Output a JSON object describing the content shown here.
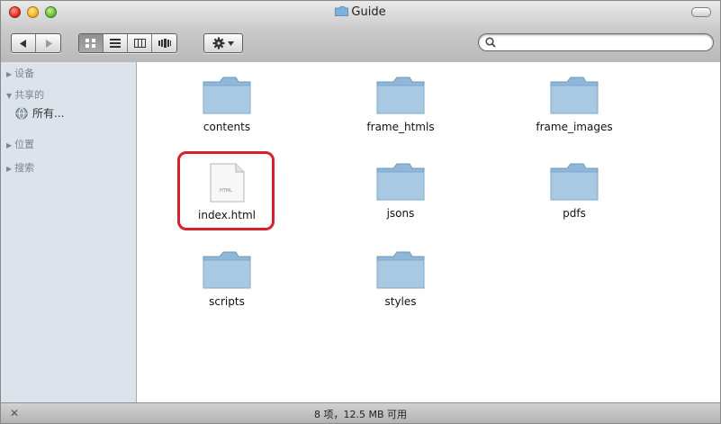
{
  "window": {
    "title": "Guide"
  },
  "sidebar": {
    "sections": [
      {
        "label": "设备"
      },
      {
        "label": "共享的"
      },
      {
        "label": "位置"
      },
      {
        "label": "搜索"
      }
    ],
    "shared_item": {
      "label": "所有..."
    }
  },
  "files": [
    {
      "name": "contents",
      "kind": "folder"
    },
    {
      "name": "frame_htmls",
      "kind": "folder"
    },
    {
      "name": "frame_images",
      "kind": "folder"
    },
    {
      "name": "index.html",
      "kind": "html-file",
      "doc_label": "HTML",
      "highlighted": true
    },
    {
      "name": "jsons",
      "kind": "folder"
    },
    {
      "name": "pdfs",
      "kind": "folder"
    },
    {
      "name": "scripts",
      "kind": "folder"
    },
    {
      "name": "styles",
      "kind": "folder"
    }
  ],
  "status": {
    "text": "8 项，12.5 MB 可用"
  },
  "colors": {
    "highlight": "#d91f2b",
    "folder": "#8fb8d8",
    "sidebar_bg": "#dce3ea"
  }
}
